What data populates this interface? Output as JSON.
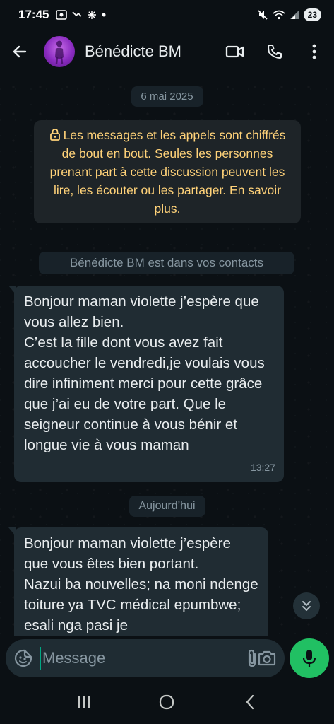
{
  "status_bar": {
    "time": "17:45",
    "battery": "23"
  },
  "header": {
    "contact_name": "Bénédicte BM"
  },
  "chat": {
    "date_separator_1": "6 mai 2025",
    "encryption_notice": "Les messages et les appels sont chiffrés de bout en bout. Seules les personnes prenant part à cette discussion peuvent les lire, les écouter ou les partager. En savoir plus.",
    "contact_notice": "Bénédicte BM est dans vos contacts",
    "messages": [
      {
        "text": "Bonjour maman violette j’espère que vous allez bien.\nC’est la fille dont vous avez fait accoucher le vendredi,je voulais vous dire infiniment merci pour cette grâce que j’ai eu de votre part. Que le seigneur continue à vous bénir et longue vie à vous maman",
        "time": "13:27"
      },
      {
        "text": "Bonjour maman violette j’espère que vous êtes bien portant.\nNazui ba nouvelles; na moni ndenge toiture ya TVC médical epumbwe; esali nga pasi je"
      }
    ],
    "date_separator_2": "Aujourd’hui"
  },
  "composer": {
    "placeholder": "Message"
  },
  "colors": {
    "accent": "#21c063",
    "bubble": "#202c33",
    "system_note_text": "#ffd279"
  },
  "icons": [
    "back-arrow-icon",
    "video-call-icon",
    "phone-icon",
    "more-options-icon",
    "lock-icon",
    "chevron-double-down-icon",
    "emoji-icon",
    "paperclip-icon",
    "camera-icon",
    "microphone-icon",
    "recents-icon",
    "home-icon",
    "back-nav-icon"
  ]
}
